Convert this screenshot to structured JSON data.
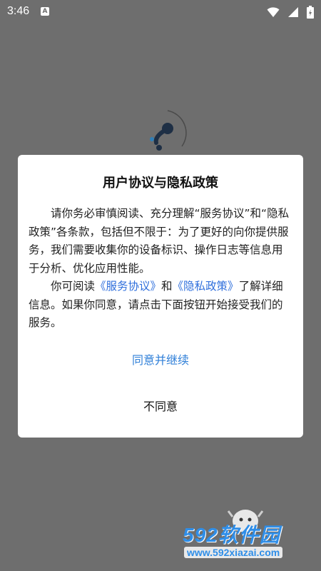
{
  "status_bar": {
    "time": "3:46",
    "notification_icon": "A",
    "icons": [
      "wifi-icon",
      "signal-icon",
      "battery-icon"
    ]
  },
  "dialog": {
    "title": "用户协议与隐私政策",
    "paragraph1": "请你务必审慎阅读、充分理解“服务协议”和“隐私政策”各条款，包括但不限于：为了更好的向你提供服务，我们需要收集你的设备标识、操作日志等信息用于分析、优化应用性能。",
    "paragraph2_prefix": "你可阅读",
    "service_link": "《服务协议》",
    "paragraph2_and": "和",
    "privacy_link": "《隐私政策》",
    "paragraph2_suffix": "了解详细信息。如果你同意，请点击下面按钮开始接受我们的服务。",
    "agree_label": "同意并继续",
    "disagree_label": "不同意"
  },
  "watermark": {
    "brand": "592软件园",
    "url": "www.592xiazai.com"
  },
  "colors": {
    "overlay": "#6e6e6e",
    "link": "#2f6fdc",
    "agree": "#2f7fd8",
    "watermark": "#2f8ee8"
  }
}
